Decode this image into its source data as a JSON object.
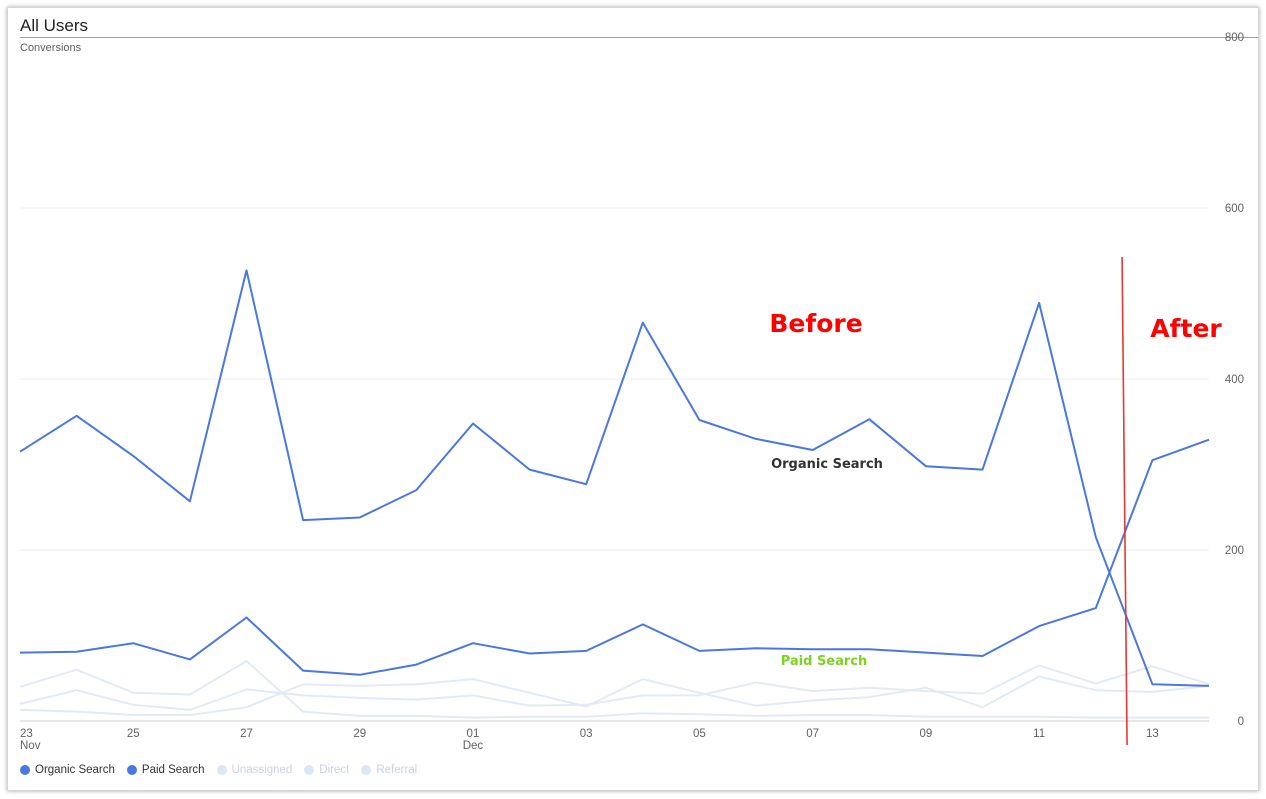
{
  "header": {
    "title": "All Users",
    "metric": "Conversions"
  },
  "legend": [
    {
      "label": "Organic Search",
      "color": "#4a77e0",
      "active": true
    },
    {
      "label": "Paid Search",
      "color": "#4a77e0",
      "active": true
    },
    {
      "label": "Unassigned",
      "color": "#dde6f6",
      "active": false
    },
    {
      "label": "Direct",
      "color": "#dde6f6",
      "active": false
    },
    {
      "label": "Referral",
      "color": "#dde6f6",
      "active": false
    }
  ],
  "annotations": {
    "before": "Before",
    "after": "After",
    "organic_label": "Organic Search",
    "paid_label": "Paid Search",
    "before_color": "#ff0000",
    "after_color": "#ff0000",
    "organic_label_color": "#333333",
    "paid_label_color": "#7ed321",
    "divider_color": "#e53935"
  },
  "chart_data": {
    "type": "line",
    "x_ticks": [
      {
        "label": "23",
        "sub": "Nov",
        "index": 0
      },
      {
        "label": "25",
        "sub": "",
        "index": 2
      },
      {
        "label": "27",
        "sub": "",
        "index": 4
      },
      {
        "label": "29",
        "sub": "",
        "index": 6
      },
      {
        "label": "01",
        "sub": "Dec",
        "index": 8
      },
      {
        "label": "03",
        "sub": "",
        "index": 10
      },
      {
        "label": "05",
        "sub": "",
        "index": 12
      },
      {
        "label": "07",
        "sub": "",
        "index": 14
      },
      {
        "label": "09",
        "sub": "",
        "index": 16
      },
      {
        "label": "11",
        "sub": "",
        "index": 18
      },
      {
        "label": "13",
        "sub": "",
        "index": 20
      }
    ],
    "ylim": [
      0,
      800
    ],
    "y_ticks": [
      "800",
      "600",
      "400",
      "200",
      "0"
    ],
    "y_tick_values": [
      800,
      600,
      400,
      200,
      0
    ],
    "grid": true,
    "legend_position": "bottom-left",
    "series": [
      {
        "name": "Organic Search",
        "color": "#4a77e0",
        "emphasis": true,
        "values": [
          315,
          357,
          310,
          257,
          527,
          235,
          238,
          270,
          348,
          294,
          277,
          466,
          352,
          330,
          317,
          353,
          298,
          294,
          489,
          215,
          43,
          41
        ]
      },
      {
        "name": "Paid Search",
        "color": "#4a77e0",
        "emphasis": true,
        "values": [
          80,
          81,
          91,
          72,
          121,
          59,
          54,
          66,
          91,
          79,
          82,
          113,
          82,
          85,
          84,
          84,
          80,
          76,
          111,
          132,
          305,
          329
        ]
      },
      {
        "name": "Unassigned",
        "color": "#e3eaf7",
        "emphasis": false,
        "values": [
          40,
          60,
          33,
          31,
          70,
          11,
          6,
          6,
          4,
          5,
          5,
          9,
          8,
          6,
          7,
          7,
          5,
          5,
          5,
          4,
          4,
          4
        ]
      },
      {
        "name": "Direct",
        "color": "#e3eaf7",
        "emphasis": false,
        "values": [
          20,
          36,
          19,
          13,
          37,
          30,
          27,
          25,
          30,
          18,
          19,
          30,
          30,
          45,
          35,
          39,
          35,
          32,
          65,
          44,
          64,
          43
        ]
      },
      {
        "name": "Referral",
        "color": "#e3eaf7",
        "emphasis": false,
        "values": [
          13,
          11,
          7,
          7,
          16,
          43,
          41,
          43,
          49,
          33,
          17,
          49,
          33,
          18,
          24,
          28,
          39,
          16,
          52,
          36,
          34,
          41
        ]
      }
    ],
    "divider_between_index": [
      19,
      20
    ]
  }
}
